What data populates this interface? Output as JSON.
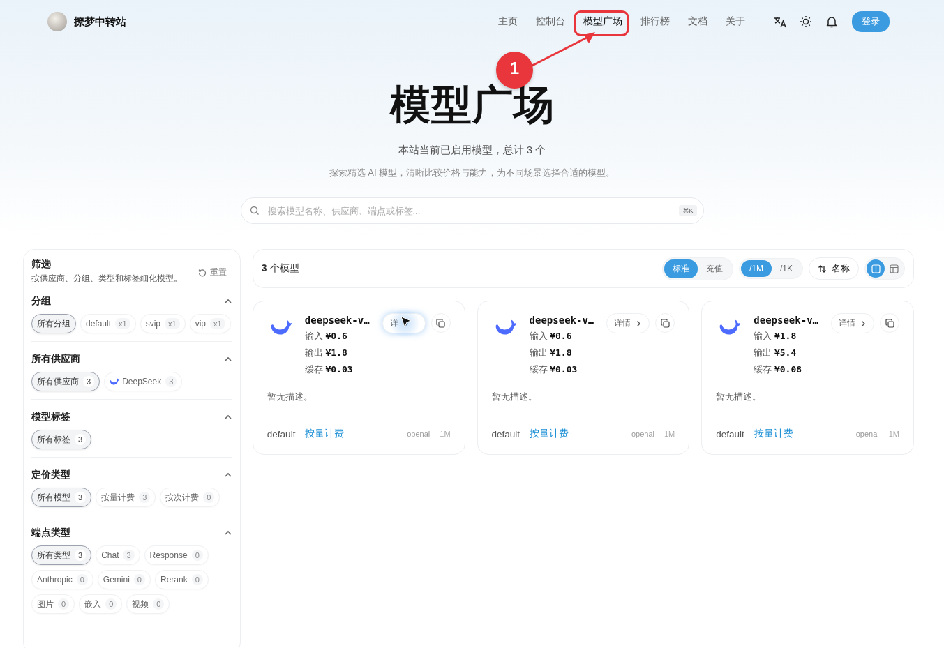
{
  "header": {
    "site_name": "撩梦中转站",
    "nav": [
      {
        "label": "主页",
        "selected": false
      },
      {
        "label": "控制台",
        "selected": false
      },
      {
        "label": "模型广场",
        "selected": true
      },
      {
        "label": "排行榜",
        "selected": false
      },
      {
        "label": "文档",
        "selected": false
      },
      {
        "label": "关于",
        "selected": false
      }
    ],
    "login_button": "登录"
  },
  "annotation": {
    "marker": "1"
  },
  "hero": {
    "title": "模型广场",
    "subtitle": "本站当前已启用模型，总计 3 个",
    "description": "探索精选 AI 模型，清晰比较价格与能力，为不同场景选择合适的模型。",
    "search": {
      "placeholder": "搜索模型名称、供应商、端点或标签...",
      "shortcut": "⌘K"
    }
  },
  "filter_panel": {
    "title": "筛选",
    "subtitle": "按供应商、分组、类型和标签细化模型。",
    "reset": "重置",
    "groups": [
      {
        "title": "分组",
        "expanded": true,
        "chips": [
          {
            "kind": "plain",
            "label": "所有分组",
            "selected": true
          },
          {
            "kind": "plain",
            "label": "default",
            "count": "x1",
            "selected": false
          },
          {
            "kind": "plain",
            "label": "svip",
            "count": "x1",
            "selected": false
          },
          {
            "kind": "plain",
            "label": "vip",
            "count": "x1",
            "selected": false
          }
        ]
      },
      {
        "title": "所有供应商",
        "expanded": true,
        "chips": [
          {
            "kind": "plain",
            "label": "所有供应商",
            "count": "3",
            "selected": true
          },
          {
            "kind": "provider",
            "label": "DeepSeek",
            "count": "3",
            "selected": false
          }
        ]
      },
      {
        "title": "模型标签",
        "expanded": true,
        "chips": [
          {
            "kind": "plain",
            "label": "所有标签",
            "count": "3",
            "selected": true
          }
        ]
      },
      {
        "title": "定价类型",
        "expanded": true,
        "chips": [
          {
            "kind": "plain",
            "label": "所有模型",
            "count": "3",
            "selected": true
          },
          {
            "kind": "plain",
            "label": "按量计费",
            "count": "3",
            "selected": false
          },
          {
            "kind": "plain",
            "label": "按次计费",
            "count": "0",
            "selected": false
          }
        ]
      },
      {
        "title": "端点类型",
        "expanded": true,
        "chips": [
          {
            "kind": "plain",
            "label": "所有类型",
            "count": "3",
            "selected": true
          },
          {
            "kind": "plain",
            "label": "Chat",
            "count": "3",
            "selected": false
          },
          {
            "kind": "plain",
            "label": "Response",
            "count": "0",
            "selected": false
          },
          {
            "kind": "plain",
            "label": "Anthropic",
            "count": "0",
            "selected": false
          },
          {
            "kind": "plain",
            "label": "Gemini",
            "count": "0",
            "selected": false
          },
          {
            "kind": "plain",
            "label": "Rerank",
            "count": "0",
            "selected": false
          },
          {
            "kind": "plain",
            "label": "图片",
            "count": "0",
            "selected": false
          },
          {
            "kind": "plain",
            "label": "嵌入",
            "count": "0",
            "selected": false
          },
          {
            "kind": "plain",
            "label": "视频",
            "count": "0",
            "selected": false
          }
        ]
      }
    ]
  },
  "toolbar": {
    "count_text": "**3** 个模型",
    "price_mode": [
      {
        "label": "标准",
        "selected": true
      },
      {
        "label": "充值",
        "selected": false
      }
    ],
    "unit": [
      {
        "label": "/1M",
        "selected": true
      },
      {
        "label": "/1K",
        "selected": false
      }
    ],
    "sort_button": "名称",
    "view": [
      {
        "kind": "grid",
        "selected": true
      },
      {
        "kind": "table",
        "selected": false
      }
    ]
  },
  "cards": [
    {
      "name": "deepseek-v…",
      "details": "详",
      "hovered": true,
      "prices": [
        {
          "label": "输入",
          "value": "¥0.6"
        },
        {
          "label": "输出",
          "value": "¥1.8"
        },
        {
          "label": "缓存",
          "value": "¥0.03"
        }
      ],
      "description": "暂无描述。",
      "group": "default",
      "billing": "按量计费",
      "endpoint": "openai",
      "context": "1M"
    },
    {
      "name": "deepseek-v…",
      "details": "详情",
      "hovered": false,
      "prices": [
        {
          "label": "输入",
          "value": "¥0.6"
        },
        {
          "label": "输出",
          "value": "¥1.8"
        },
        {
          "label": "缓存",
          "value": "¥0.03"
        }
      ],
      "description": "暂无描述。",
      "group": "default",
      "billing": "按量计费",
      "endpoint": "openai",
      "context": "1M"
    },
    {
      "name": "deepseek-v…",
      "details": "详情",
      "hovered": false,
      "prices": [
        {
          "label": "输入",
          "value": "¥1.8"
        },
        {
          "label": "输出",
          "value": "¥5.4"
        },
        {
          "label": "缓存",
          "value": "¥0.08"
        }
      ],
      "description": "暂无描述。",
      "group": "default",
      "billing": "按量计费",
      "endpoint": "openai",
      "context": "1M"
    }
  ]
}
